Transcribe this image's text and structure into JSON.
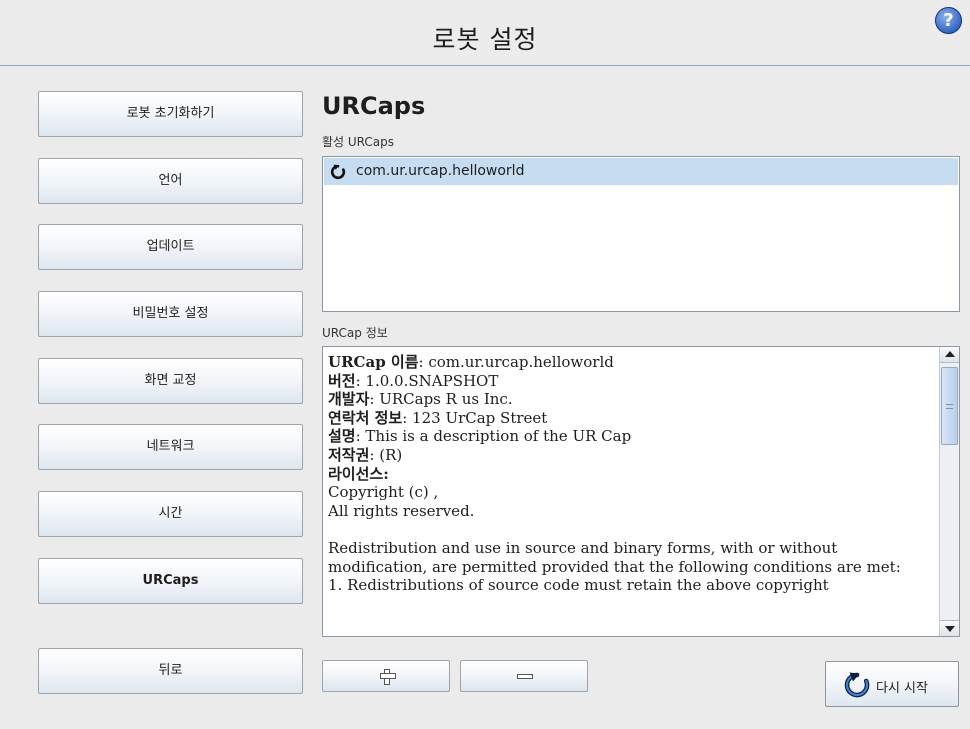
{
  "header": {
    "title": "로봇 설정",
    "help_label": "?"
  },
  "sidebar": {
    "items": [
      {
        "label": "로봇 초기화하기"
      },
      {
        "label": "언어"
      },
      {
        "label": "업데이트"
      },
      {
        "label": "비밀번호 설정"
      },
      {
        "label": "화면 교정"
      },
      {
        "label": "네트워크"
      },
      {
        "label": "시간"
      },
      {
        "label": "URCaps",
        "active": true
      }
    ],
    "back_label": "뒤로"
  },
  "main": {
    "section_title": "URCaps",
    "active_label": "활성 URCaps",
    "active_list": [
      {
        "name": "com.ur.urcap.helloworld",
        "icon": "refresh-icon"
      }
    ],
    "info_label": "URCap 정보",
    "info": {
      "name_key": "URCap 이름",
      "name_val": ": com.ur.urcap.helloworld",
      "version_key": "버전",
      "version_val": ": 1.0.0.SNAPSHOT",
      "vendor_key": "개발자",
      "vendor_val": ": URCaps R us Inc.",
      "contact_key": "연락처 정보",
      "contact_val": ": 123 UrCap Street",
      "desc_key": "설명",
      "desc_val": ": This is a description of the UR Cap",
      "copyright_key": "저작권",
      "copyright_val": ": (R)",
      "license_key": "라이선스",
      "license_val": ":",
      "line1": "Copyright (c) ,",
      "line2": "All rights reserved.",
      "para1": "Redistribution and use in source and binary forms, with or without modification, are permitted provided that the following conditions are met:",
      "para2": "1. Redistributions of source code must retain the above copyright"
    }
  },
  "footer": {
    "add_icon": "plus-icon",
    "remove_icon": "minus-icon",
    "restart_label": "다시 시작",
    "restart_icon": "refresh-icon"
  },
  "colors": {
    "selection": "#c6dcf0",
    "button_top": "#ffffff",
    "button_bottom": "#dde6ef",
    "help": "#2f62c2"
  }
}
